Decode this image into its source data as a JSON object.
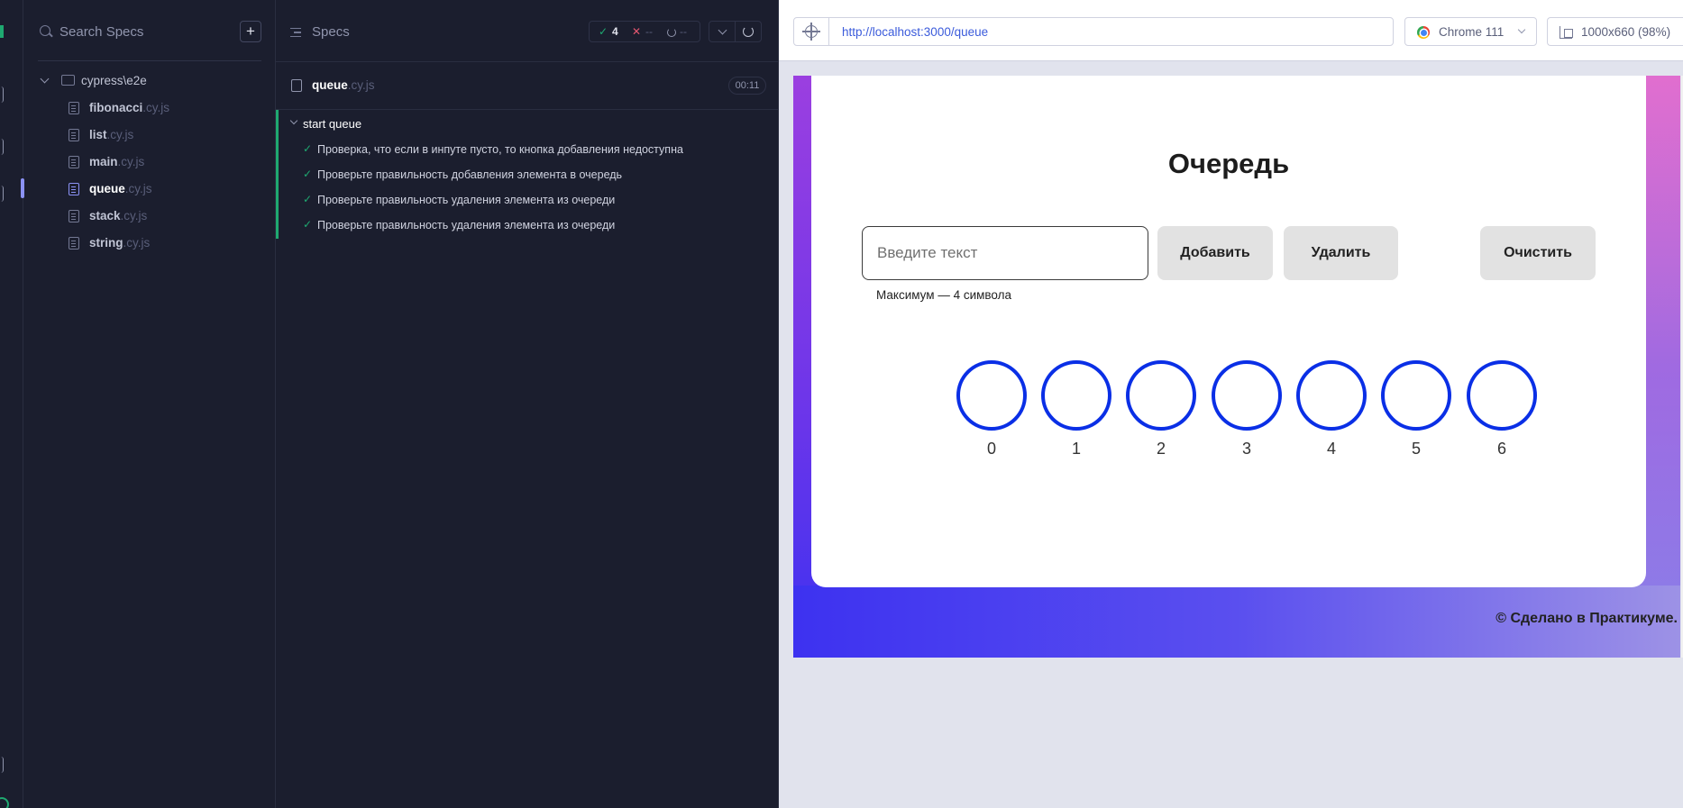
{
  "specs_panel": {
    "search_placeholder": "Search Specs",
    "add_label": "+",
    "folder": "cypress\\e2e",
    "files": [
      {
        "name": "fibonacci",
        "ext": ".cy.js",
        "active": false
      },
      {
        "name": "list",
        "ext": ".cy.js",
        "active": false
      },
      {
        "name": "main",
        "ext": ".cy.js",
        "active": false
      },
      {
        "name": "queue",
        "ext": ".cy.js",
        "active": true
      },
      {
        "name": "stack",
        "ext": ".cy.js",
        "active": false
      },
      {
        "name": "string",
        "ext": ".cy.js",
        "active": false
      }
    ]
  },
  "reporter": {
    "title": "Specs",
    "stats": {
      "pass_icon": "✓",
      "passed": "4",
      "fail_icon": "✕",
      "failed": "--",
      "pending": "--"
    },
    "spec_file": {
      "name": "queue",
      "ext": ".cy.js",
      "duration": "00:11"
    },
    "suite": {
      "title": "start queue",
      "tests": [
        "Проверка, что если в инпуте пусто, то кнопка добавления недоступна",
        "Проверьте правильность добавления элемента в очередь",
        "Проверьте правильность удаления элемента из очереди",
        "Проверьте правильность удаления элемента из очереди"
      ],
      "check": "✓"
    }
  },
  "browser": {
    "url": "http://localhost:3000/queue",
    "browser_name": "Chrome 111",
    "viewport": "1000x660 (98%)"
  },
  "app": {
    "title": "Очередь",
    "input_placeholder": "Введите текст",
    "add_button": "Добавить",
    "delete_button": "Удалить",
    "clear_button": "Очистить",
    "hint": "Максимум — 4 символа",
    "queue_indices": [
      "0",
      "1",
      "2",
      "3",
      "4",
      "5",
      "6"
    ],
    "footer": "© Сделано в Практикуме."
  },
  "colors": {
    "pass": "#1fa971",
    "fail": "#e45770",
    "accent": "#8b92f5",
    "circle_border": "#0a2fe6"
  }
}
